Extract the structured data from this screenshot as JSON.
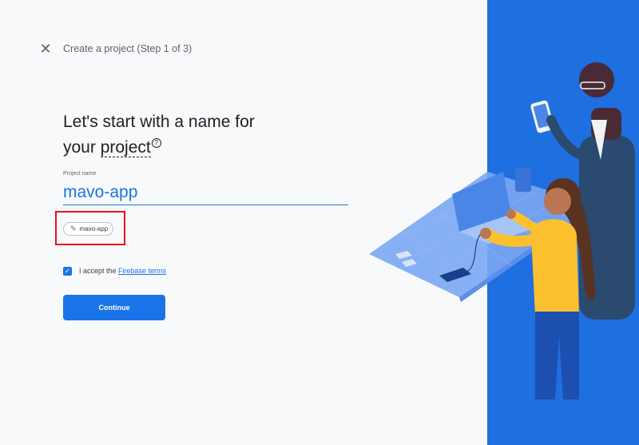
{
  "header": {
    "close_icon": "close-icon",
    "step_title": "Create a project (Step 1 of 3)"
  },
  "heading": {
    "line1": "Let's start with a name for",
    "line2_prefix": "your ",
    "line2_link": "project",
    "help_icon": "help-circle-icon",
    "help_glyph": "?"
  },
  "project_name": {
    "label": "Project name",
    "value": "mavo-app"
  },
  "project_id_chip": {
    "icon": "pencil-icon",
    "label": "mavo-app"
  },
  "terms": {
    "checked": true,
    "prefix": "I accept the ",
    "link": "Firebase terms"
  },
  "actions": {
    "continue_label": "Continue"
  },
  "colors": {
    "accent": "#1a73e8",
    "illustration_bg": "#1e6fe0",
    "highlight_box": "#e8111a"
  }
}
